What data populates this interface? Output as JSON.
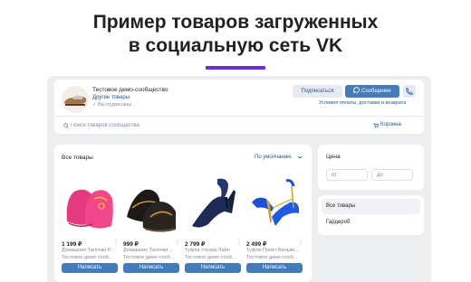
{
  "headline": {
    "line1": "Пример товаров загруженных",
    "line2": "в социальную сеть VK"
  },
  "colors": {
    "accent": "#6a2ddc",
    "vk_blue": "#447bba",
    "link": "#2a5885",
    "background": "#edeef0"
  },
  "community": {
    "name": "Тестовое демо-сообщество",
    "sub": "Другие товары",
    "status": "✓ Вы подписаны",
    "subscribed_label": "Подписаться",
    "message_label": "Сообщение",
    "conditions_link": "Условия оплаты, доставки и возврата",
    "avatar_icon": "slipper-photo"
  },
  "search": {
    "placeholder": "Поиск товаров сообщества",
    "icon": "search-icon"
  },
  "cart": {
    "label": "Корзина",
    "icon": "cart-icon"
  },
  "goods": {
    "title": "Все товары",
    "sort_label": "По умолчанию",
    "items": [
      {
        "price": "1 199 ₽",
        "name": "Домашние Тапочки Р...",
        "seller": "Тестовое демо-сооб...",
        "button": "Написать",
        "image": "pink-slippers"
      },
      {
        "price": "999 ₽",
        "name": "Домашние Тапочки ...",
        "seller": "Тестовое демо-сооб...",
        "button": "Написать",
        "image": "black-slippers"
      },
      {
        "price": "2 799 ₽",
        "name": "Туфли Ультра Лайн",
        "seller": "Тестовое демо-сооб...",
        "button": "Написать",
        "image": "navy-pumps"
      },
      {
        "price": "2 499 ₽",
        "name": "Туфли Полет Вальки...",
        "seller": "Тестовое демо-сооб...",
        "button": "Написать",
        "image": "blue-strappy-heels"
      }
    ]
  },
  "price_filter": {
    "title": "Цена",
    "from_placeholder": "от",
    "to_placeholder": "до"
  },
  "categories": [
    {
      "label": "Все товары",
      "active": true
    },
    {
      "label": "Гардероб",
      "active": false
    }
  ]
}
